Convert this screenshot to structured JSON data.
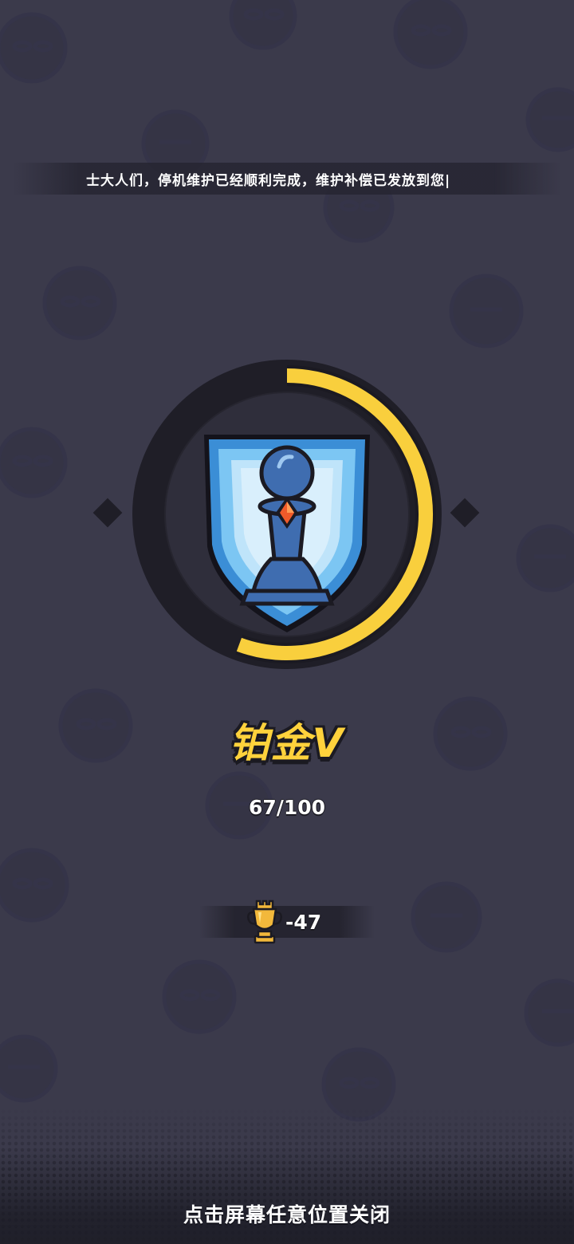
{
  "announcement": {
    "text": "士大人们，停机维护已经顺利完成，维护补偿已发放到您|"
  },
  "rank": {
    "name": "铂金V",
    "progress_text": "67/100",
    "progress_fraction": 0.67,
    "icon": "pawn-shield-icon",
    "ring_color": "#f9cf3d",
    "shield_color": "#4a9ee0"
  },
  "trophy": {
    "icon": "trophy-icon",
    "delta": "-47"
  },
  "footer": {
    "close_hint": "点击屏幕任意位置关闭"
  },
  "colors": {
    "background": "#3b3a4b",
    "accent_yellow": "#ffd23c"
  }
}
